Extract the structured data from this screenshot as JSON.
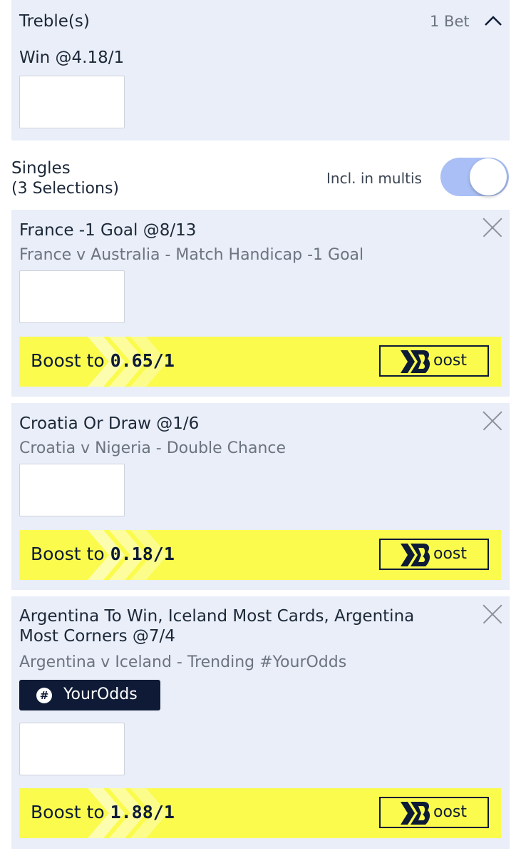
{
  "treble": {
    "title": "Treble(s)",
    "bet_count": "1 Bet",
    "win_label": "Win @4.18/1",
    "stake_value": ""
  },
  "singles": {
    "title": "Singles",
    "subtitle": "(3 Selections)",
    "multis_label": "Incl. in multis",
    "multis_on": true
  },
  "selections": [
    {
      "title": "France -1 Goal @8/13",
      "subtitle": "France v Australia - Match Handicap -1 Goal",
      "stake_value": "",
      "boost_prefix": "Boost to ",
      "boost_odds": "0.65/1",
      "boost_button": "oost"
    },
    {
      "title": "Croatia Or Draw @1/6",
      "subtitle": "Croatia v Nigeria - Double Chance",
      "stake_value": "",
      "boost_prefix": "Boost to ",
      "boost_odds": "0.18/1",
      "boost_button": "oost"
    },
    {
      "title_line1": "Argentina To Win, Iceland Most Cards, Argentina",
      "title_line2": "Most Corners @7/4",
      "subtitle": "Argentina v Iceland - Trending #YourOdds",
      "badge_icon": "#",
      "badge": "YourOdds",
      "stake_value": "",
      "boost_prefix": "Boost to ",
      "boost_odds": "1.88/1",
      "boost_button": "oost"
    }
  ],
  "icons": {
    "collapse": "chevron-up-icon",
    "remove": "close-icon",
    "boost_logo": "boost-b-logo-icon",
    "hash": "hashtag-icon"
  },
  "colors": {
    "card_bg": "#e9eef8",
    "boost_yellow": "#fbfb4e",
    "navy": "#0d1b36",
    "toggle_on": "#a9bff5"
  }
}
